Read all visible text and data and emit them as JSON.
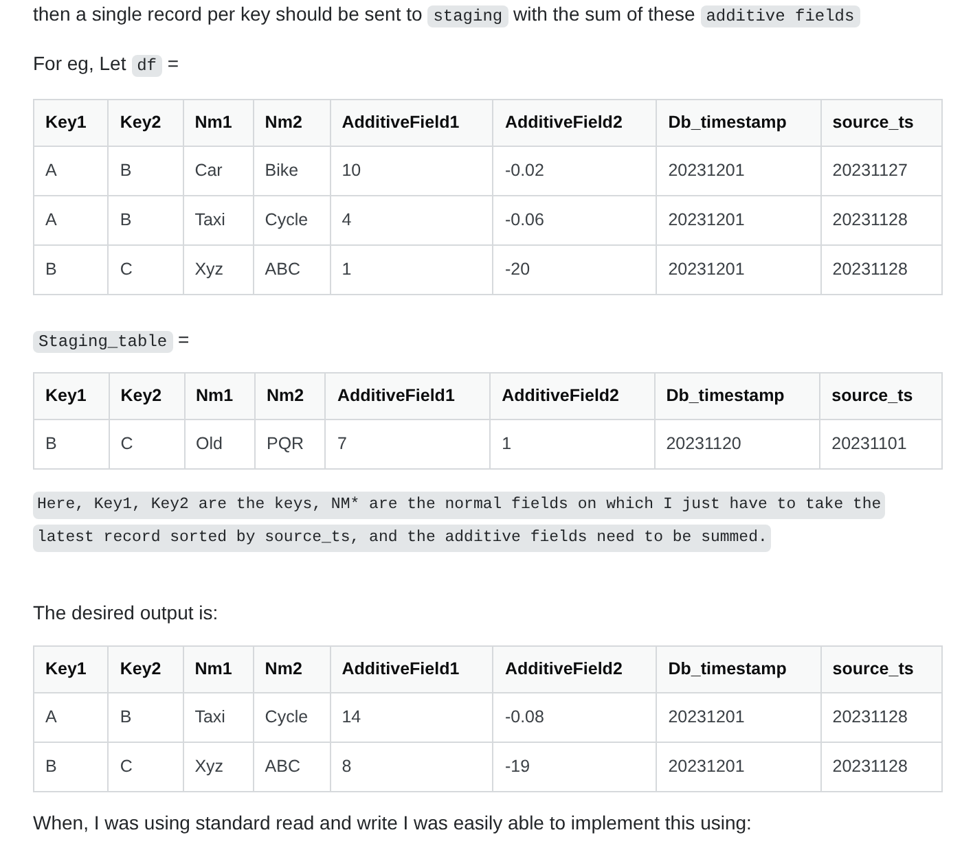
{
  "blocks": [
    {
      "kind": "para",
      "segments": [
        {
          "kind": "text",
          "text": "then a single record per key should be sent to "
        },
        {
          "kind": "code",
          "text": "staging"
        },
        {
          "kind": "text",
          "text": " with the sum of these "
        },
        {
          "kind": "code",
          "text": "additive fields"
        }
      ]
    },
    {
      "kind": "para",
      "segments": [
        {
          "kind": "text",
          "text": "For eg, Let "
        },
        {
          "kind": "code",
          "text": "df"
        },
        {
          "kind": "text",
          "text": " ="
        }
      ]
    },
    {
      "kind": "table",
      "columns": [
        "Key1",
        "Key2",
        "Nm1",
        "Nm2",
        "AdditiveField1",
        "AdditiveField2",
        "Db_timestamp",
        "source_ts"
      ],
      "rows": [
        [
          "A",
          "B",
          "Car",
          "Bike",
          "10",
          "-0.02",
          "20231201",
          "20231127"
        ],
        [
          "A",
          "B",
          "Taxi",
          "Cycle",
          "4",
          "-0.06",
          "20231201",
          "20231128"
        ],
        [
          "B",
          "C",
          "Xyz",
          "ABC",
          "1",
          "-20",
          "20231201",
          "20231128"
        ]
      ]
    },
    {
      "kind": "para",
      "segments": [
        {
          "kind": "code",
          "text": "Staging_table"
        },
        {
          "kind": "text",
          "text": " ="
        }
      ]
    },
    {
      "kind": "table",
      "columns": [
        "Key1",
        "Key2",
        "Nm1",
        "Nm2",
        "AdditiveField1",
        "AdditiveField2",
        "Db_timestamp",
        "source_ts"
      ],
      "rows": [
        [
          "B",
          "C",
          "Old",
          "PQR",
          "7",
          "1",
          "20231120",
          "20231101"
        ]
      ]
    },
    {
      "kind": "codepara",
      "lines": [
        "Here, Key1, Key2 are the keys, NM* are the normal fields on which I just have to take the",
        "latest record sorted by source_ts, and the additive fields need to be summed."
      ]
    },
    {
      "kind": "para",
      "segments": [
        {
          "kind": "text",
          "text": "The desired output is:"
        }
      ]
    },
    {
      "kind": "table",
      "columns": [
        "Key1",
        "Key2",
        "Nm1",
        "Nm2",
        "AdditiveField1",
        "AdditiveField2",
        "Db_timestamp",
        "source_ts"
      ],
      "rows": [
        [
          "A",
          "B",
          "Taxi",
          "Cycle",
          "14",
          "-0.08",
          "20231201",
          "20231128"
        ],
        [
          "B",
          "C",
          "Xyz",
          "ABC",
          "8",
          "-19",
          "20231201",
          "20231128"
        ]
      ]
    },
    {
      "kind": "para",
      "segments": [
        {
          "kind": "text",
          "text": "When, I was using standard read and write I was easily able to implement this using:"
        }
      ]
    }
  ]
}
